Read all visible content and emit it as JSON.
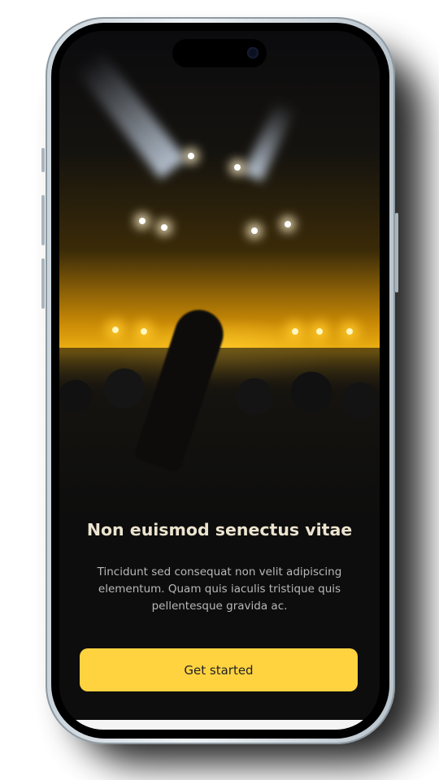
{
  "onboarding": {
    "title": "Non euismod senectus vitae",
    "description": "Tincidunt sed consequat non velit adipiscing elementum. Quam quis iaculis tristique quis pellentesque gravida ac.",
    "cta_label": "Get started"
  },
  "colors": {
    "accent": "#ffd340",
    "background": "#0d0d0d"
  }
}
